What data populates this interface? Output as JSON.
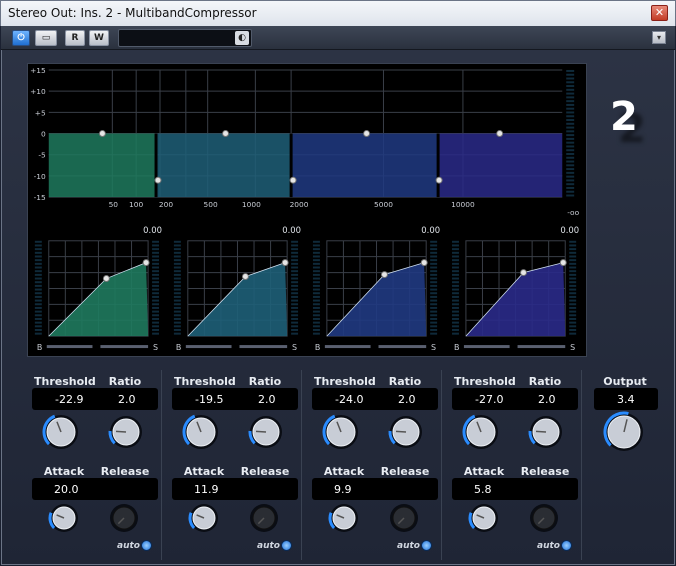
{
  "window": {
    "title": "Stereo Out: Ins. 2 - MultibandCompressor",
    "close_label": "✕"
  },
  "toolbar": {
    "power_label": "⏻",
    "bypass_label": "▭",
    "read_label": "R",
    "write_label": "W",
    "preset_value": "",
    "menu_label": "▾"
  },
  "plugin": {
    "slot_number": "2"
  },
  "display": {
    "y_ticks": [
      "+15",
      "+10",
      "+5",
      "0",
      "-5",
      "-10",
      "-15"
    ],
    "x_ticks": [
      "50",
      "100",
      "200",
      "500",
      "1000",
      "2000",
      "5000",
      "10000"
    ],
    "meter_scale_label": "-oo",
    "band_colors": [
      "#1f7a5e",
      "#1e5f78",
      "#203a82",
      "#2a2a8a"
    ],
    "graphs": [
      {
        "value": "0.00",
        "min_label": "B",
        "max_label": "S"
      },
      {
        "value": "0.00",
        "min_label": "B",
        "max_label": "S"
      },
      {
        "value": "0.00",
        "min_label": "B",
        "max_label": "S"
      },
      {
        "value": "0.00",
        "min_label": "B",
        "max_label": "S"
      }
    ]
  },
  "bands": [
    {
      "threshold_label": "Threshold",
      "threshold": "-22.9",
      "ratio_label": "Ratio",
      "ratio": "2.0",
      "attack_label": "Attack",
      "attack": "20.0",
      "release_label": "Release",
      "auto_label": "auto"
    },
    {
      "threshold_label": "Threshold",
      "threshold": "-19.5",
      "ratio_label": "Ratio",
      "ratio": "2.0",
      "attack_label": "Attack",
      "attack": "11.9",
      "release_label": "Release",
      "auto_label": "auto"
    },
    {
      "threshold_label": "Threshold",
      "threshold": "-24.0",
      "ratio_label": "Ratio",
      "ratio": "2.0",
      "attack_label": "Attack",
      "attack": "9.9",
      "release_label": "Release",
      "auto_label": "auto"
    },
    {
      "threshold_label": "Threshold",
      "threshold": "-27.0",
      "ratio_label": "Ratio",
      "ratio": "2.0",
      "attack_label": "Attack",
      "attack": "5.8",
      "release_label": "Release",
      "auto_label": "auto"
    }
  ],
  "output": {
    "label": "Output",
    "value": "3.4"
  },
  "icons": {
    "close": "close-icon",
    "power": "power-icon",
    "preset_menu": "preset-menu-icon",
    "menu": "chevron-down-icon"
  }
}
